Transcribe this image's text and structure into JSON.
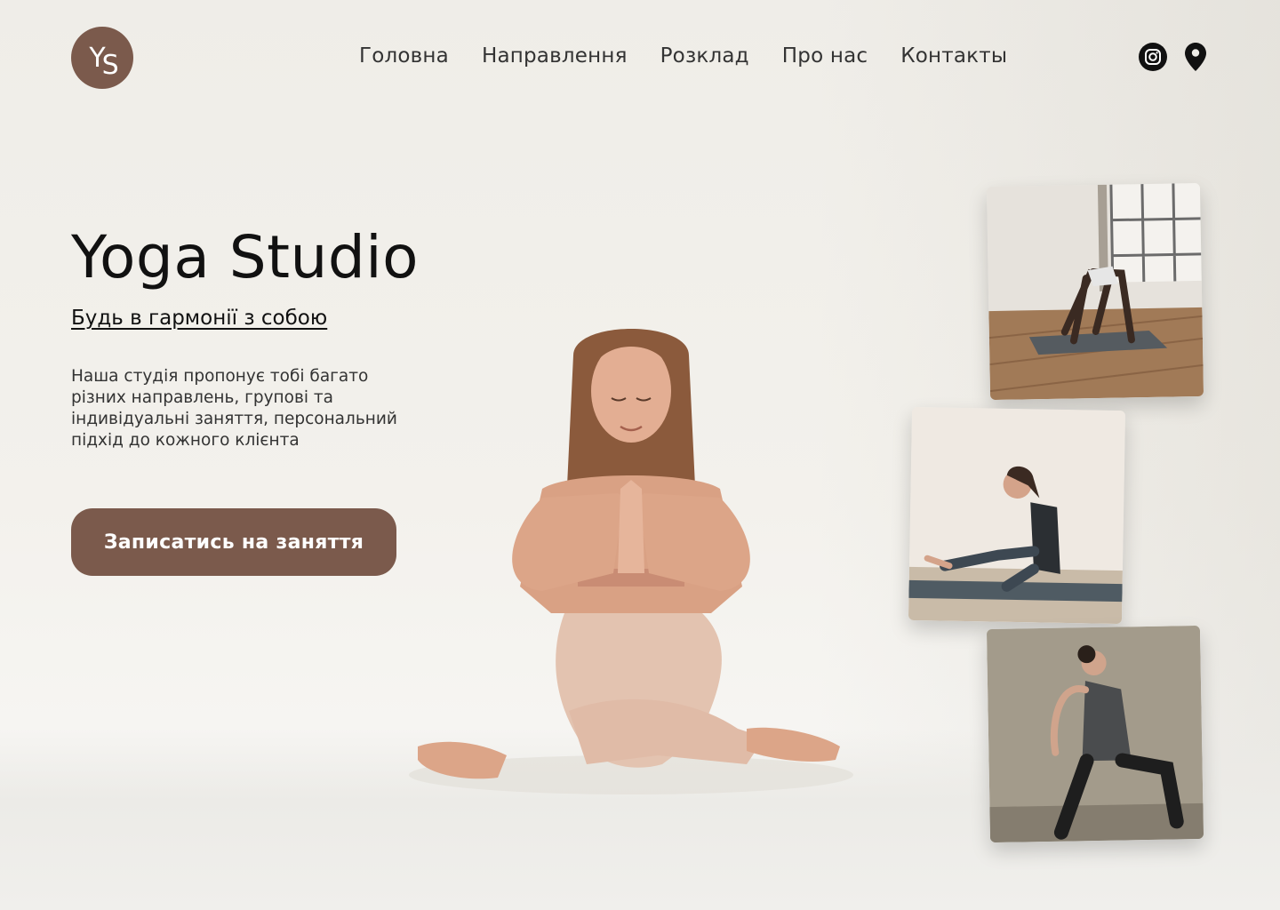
{
  "header": {
    "logo_text": "YS",
    "nav": [
      {
        "label": "Головна"
      },
      {
        "label": "Направлення"
      },
      {
        "label": "Розклад"
      },
      {
        "label": "Про нас"
      },
      {
        "label": "Контакты"
      }
    ],
    "icons": [
      "instagram-icon",
      "location-pin-icon"
    ]
  },
  "hero": {
    "title": "Yoga Studio",
    "subtitle": "Будь в гармонії з собою",
    "description": "Наша студія  пропонує тобі багато різних направлень, групові та індивідуальні заняття, персональний підхід до кожного клієнта",
    "cta_label": "Записатись на заняття"
  },
  "colors": {
    "accent": "#7b5a4c",
    "background": "#efede8",
    "text": "#111111"
  }
}
